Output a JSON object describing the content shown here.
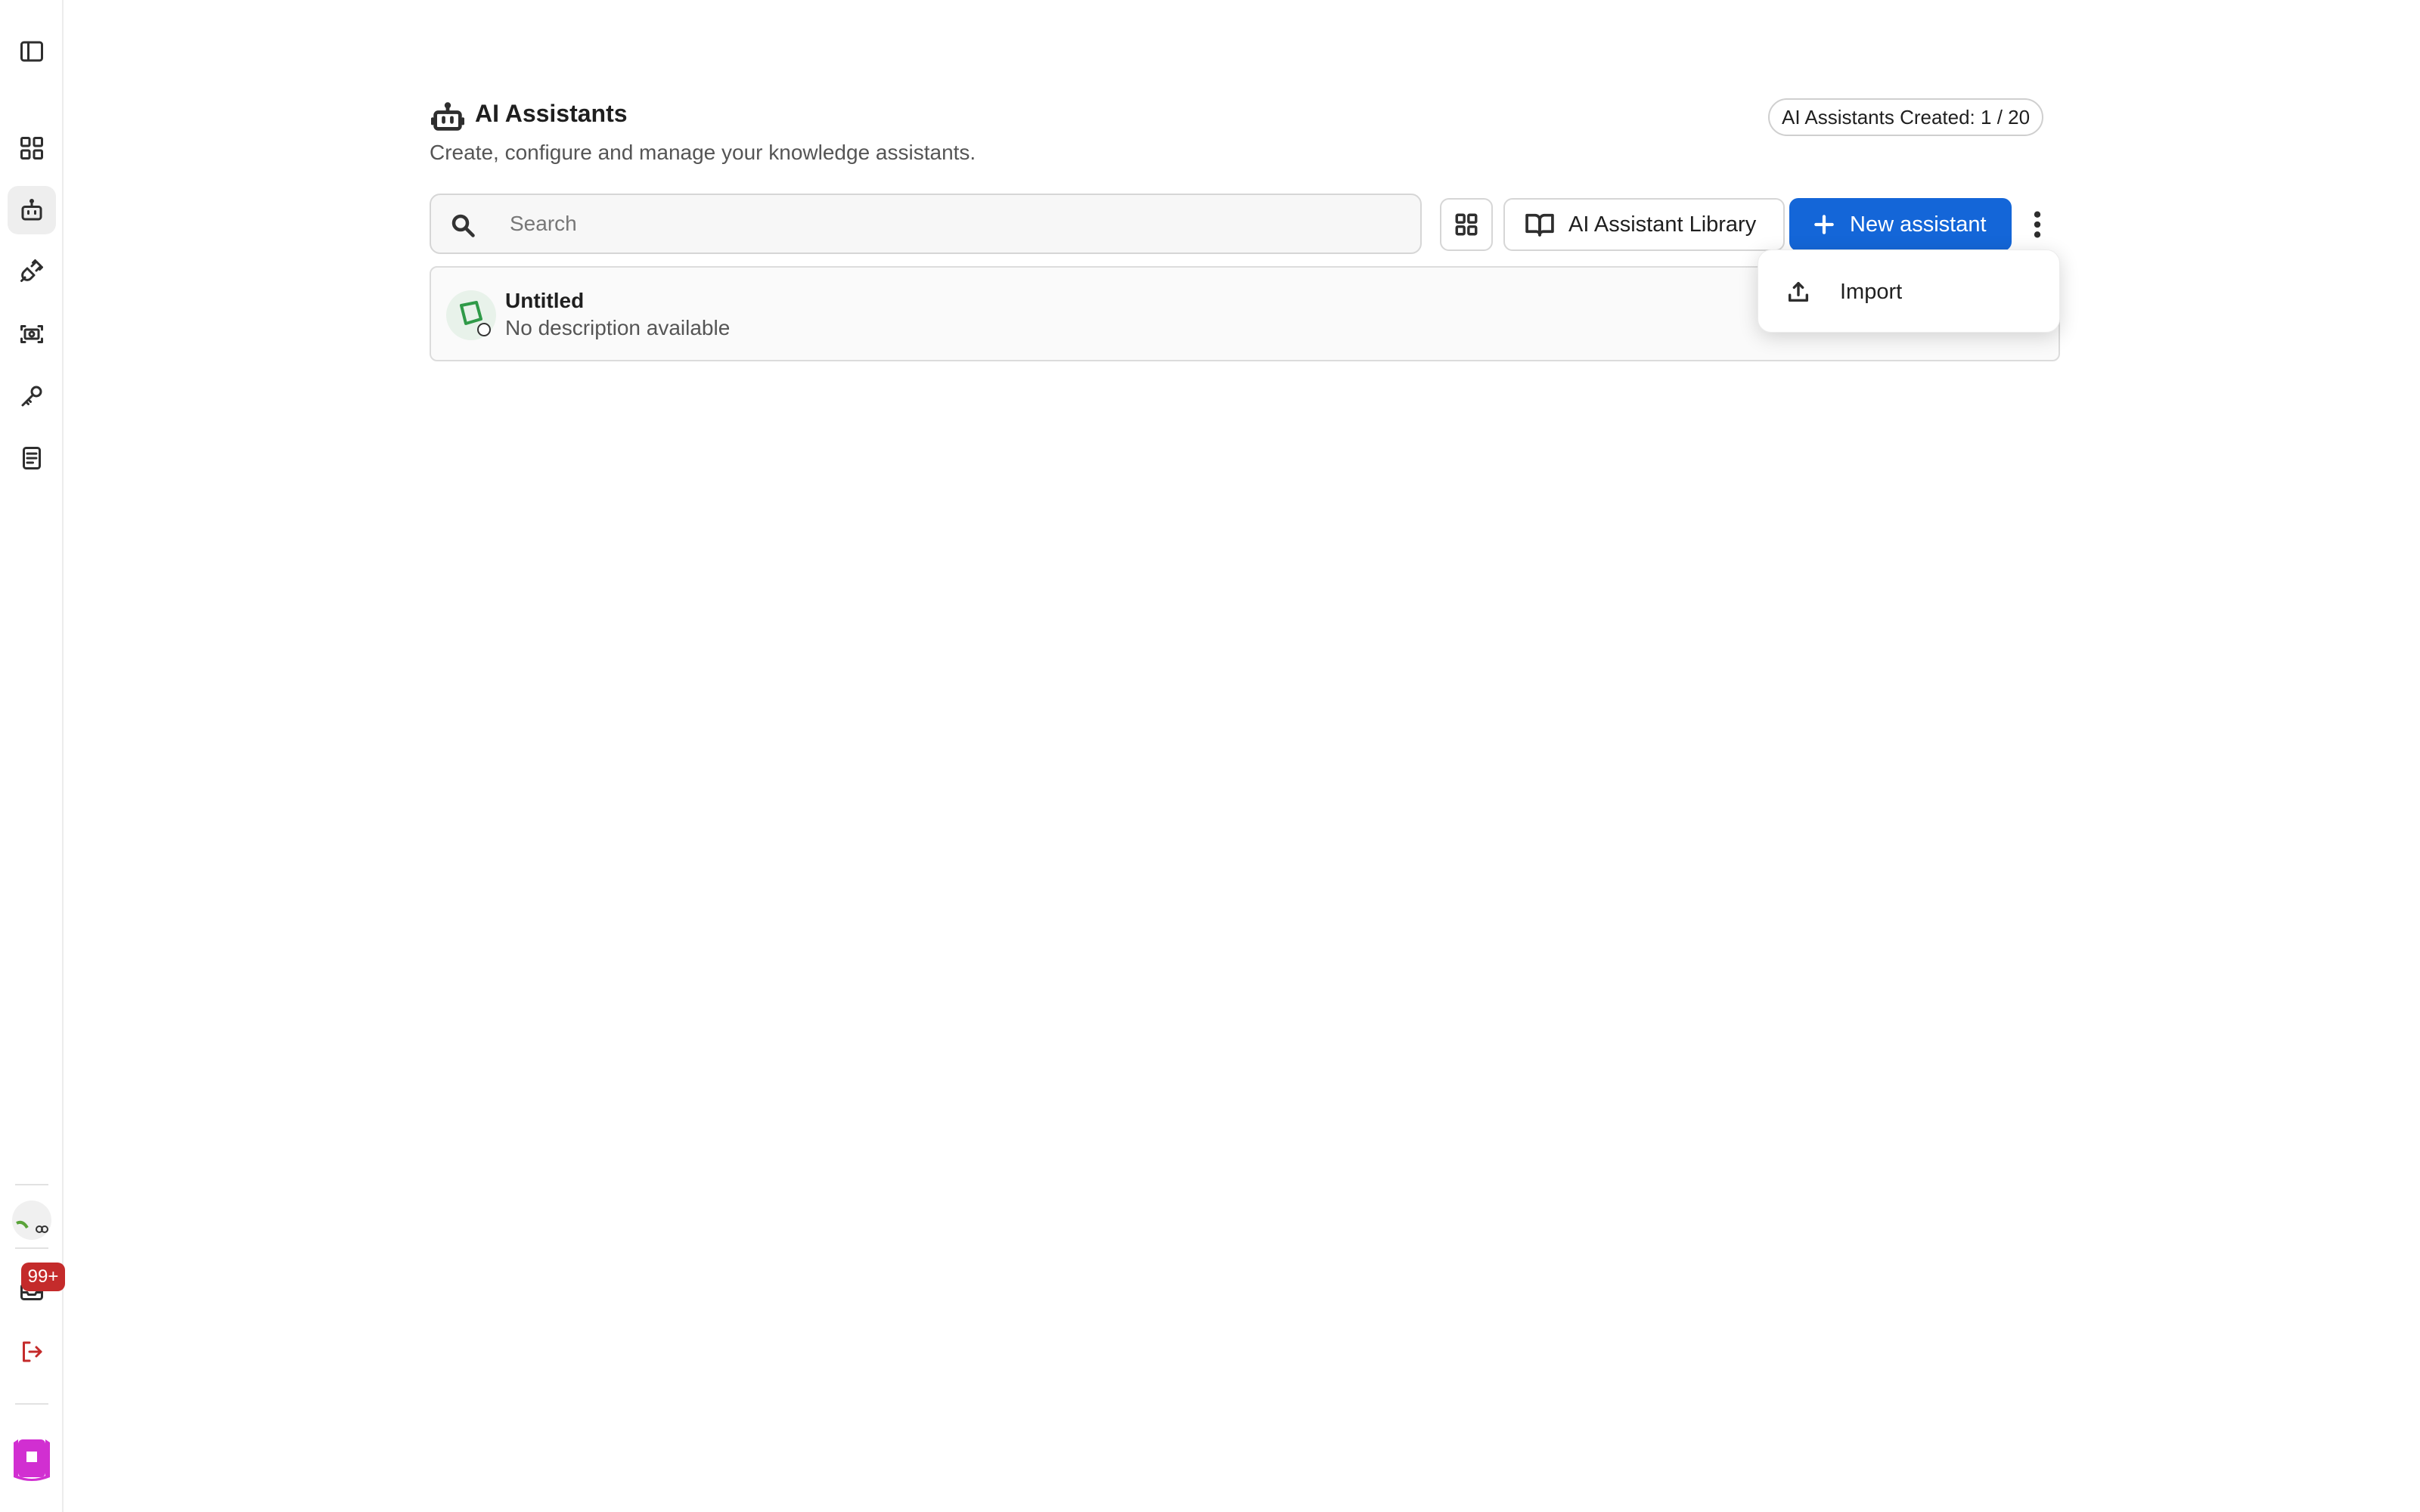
{
  "sidebar": {
    "items": [
      {
        "name": "sidebar-toggle-icon"
      },
      {
        "name": "dashboard-grid-icon"
      },
      {
        "name": "robot-icon",
        "active": true
      },
      {
        "name": "plug-icon"
      },
      {
        "name": "screenshot-icon"
      },
      {
        "name": "key-icon"
      },
      {
        "name": "document-icon"
      }
    ],
    "notification_badge": "99+",
    "colors": {
      "badge": "#c42b2b",
      "logout": "#c42b2b",
      "app_logo": "#d12fd1"
    }
  },
  "header": {
    "title": "AI Assistants",
    "subtitle": "Create, configure and manage your knowledge assistants.",
    "quota": "AI Assistants Created: 1 / 20"
  },
  "toolbar": {
    "search_placeholder": "Search",
    "search_value": "",
    "library_label": "AI Assistant Library",
    "new_label": "New assistant",
    "accent_color": "#1466d8"
  },
  "assistants": [
    {
      "title": "Untitled",
      "description": "No description available"
    }
  ],
  "menu": {
    "items": [
      {
        "label": "Import",
        "icon": "upload-icon"
      }
    ]
  }
}
